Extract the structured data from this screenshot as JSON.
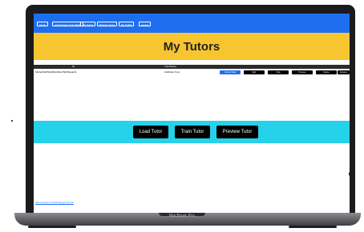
{
  "nav": {
    "items": [
      "Home",
      "Appointment Time Model",
      "My Tutors",
      "Browse Tutors",
      "My Profile",
      "Logout"
    ]
  },
  "page": {
    "title": "My Tutors"
  },
  "table": {
    "headers": [
      "ID",
      "TutorName"
    ],
    "rows": [
      {
        "id": "69cbe8d3253a5d6e30be78d266ead41",
        "name": "AddData Tutor",
        "actions": [
          "Upload Data",
          "Edit",
          "Train",
          "Preview",
          "Delete",
          "Rename"
        ]
      }
    ]
  },
  "actions": {
    "load": "Load Tutor",
    "train": "Train Tutor",
    "preview": "Preview Tutor"
  },
  "footer": {
    "link": "https://example.com/edit-data-gpt-tutor-trial"
  },
  "device": {
    "brand": "MacBook Pro"
  },
  "colors": {
    "nav": "#1e6ff0",
    "banner": "#f7c52f",
    "band": "#26d2ea"
  }
}
